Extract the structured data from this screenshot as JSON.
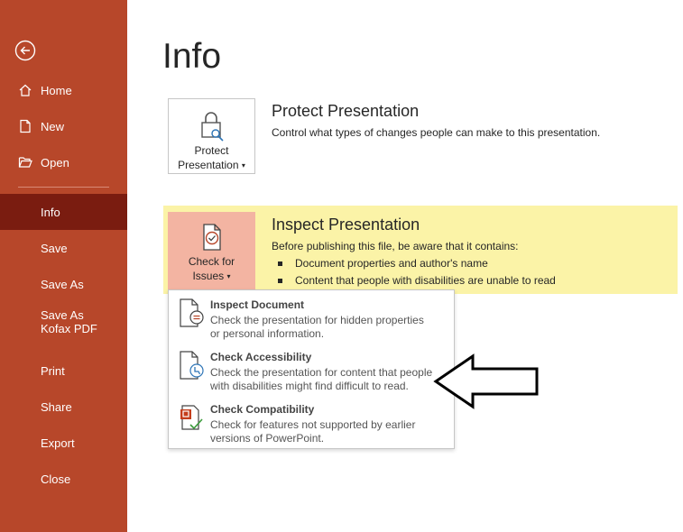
{
  "sidebar": {
    "items": [
      {
        "label": "Home",
        "icon": "home-icon"
      },
      {
        "label": "New",
        "icon": "new-file-icon"
      },
      {
        "label": "Open",
        "icon": "folder-open-icon"
      },
      {
        "label": "Info"
      },
      {
        "label": "Save"
      },
      {
        "label": "Save As"
      },
      {
        "label": "Save As Kofax PDF"
      },
      {
        "label": "Print"
      },
      {
        "label": "Share"
      },
      {
        "label": "Export"
      },
      {
        "label": "Close"
      }
    ],
    "selected": "Info",
    "bg_color": "#b7472a",
    "selected_color": "#7a1c10"
  },
  "page": {
    "title": "Info"
  },
  "protect": {
    "button_line1": "Protect",
    "button_line2": "Presentation",
    "title": "Protect Presentation",
    "description": "Control what types of changes people can make to this presentation."
  },
  "inspect": {
    "button_line1": "Check for",
    "button_line2": "Issues",
    "title": "Inspect Presentation",
    "description": "Before publishing this file, be aware that it contains:",
    "bullets": [
      "Document properties and author's name",
      "Content that people with disabilities are unable to read"
    ],
    "highlight_color": "#fbf3a7"
  },
  "dropdown": {
    "items": [
      {
        "title": "Inspect Document",
        "desc1": "Check the presentation for hidden properties",
        "desc2": "or personal information."
      },
      {
        "title": "Check Accessibility",
        "desc1": "Check the presentation for content that people",
        "desc2": "with disabilities might find difficult to read."
      },
      {
        "title": "Check Compatibility",
        "desc1": "Check for features not supported by earlier",
        "desc2": "versions of PowerPoint."
      }
    ]
  }
}
